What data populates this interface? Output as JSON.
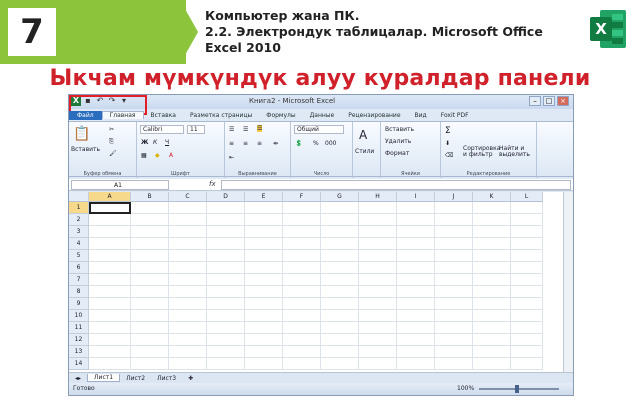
{
  "slide": {
    "grade": "7",
    "header_line1": "Компьютер жана ПК.",
    "header_line2": "2.2. Электрондук таблицалар. Microsoft Office Excel 2010",
    "headline": "Ыкчам мүмкүндүк алуу куралдар панели",
    "accent_red": "#d0202a",
    "accent_green": "#8cc43c",
    "logo": "excel-logo-icon",
    "logo_text": "X"
  },
  "excel": {
    "title": "Книга2 - Microsoft Excel",
    "tabs": [
      "Файл",
      "Главная",
      "Вставка",
      "Разметка страницы",
      "Формулы",
      "Данные",
      "Рецензирование",
      "Вид",
      "Foxit PDF"
    ],
    "active_tab": "Главная",
    "ribbon": {
      "clipboard": {
        "paste": "Вставить",
        "label": "Буфер обмена"
      },
      "font": {
        "name": "Calibri",
        "size": "11",
        "label": "Шрифт",
        "bold": "Ж",
        "italic": "К",
        "underline": "Ч"
      },
      "alignment": {
        "label": "Выравнивание"
      },
      "number": {
        "format": "Общий",
        "percent": "%",
        "thousands": "000",
        "label": "Число"
      },
      "styles": {
        "label": "Стили"
      },
      "cells": {
        "insert": "Вставить",
        "delete": "Удалить",
        "format": "Формат",
        "label": "Ячейки"
      },
      "editing": {
        "sum": "Σ",
        "sort": "Сортировка и фильтр",
        "find": "Найти и выделить",
        "label": "Редактирование"
      }
    },
    "name_box": "A1",
    "fx": "fx",
    "columns": [
      "A",
      "B",
      "C",
      "D",
      "E",
      "F",
      "G",
      "H",
      "I",
      "J",
      "K",
      "L"
    ],
    "rows": [
      "1",
      "2",
      "3",
      "4",
      "5",
      "6",
      "7",
      "8",
      "9",
      "10",
      "11",
      "12",
      "13",
      "14"
    ],
    "sheets": [
      "Лист1",
      "Лист2",
      "Лист3"
    ],
    "active_sheet": "Лист1",
    "status": "Готово",
    "zoom": "100%"
  }
}
